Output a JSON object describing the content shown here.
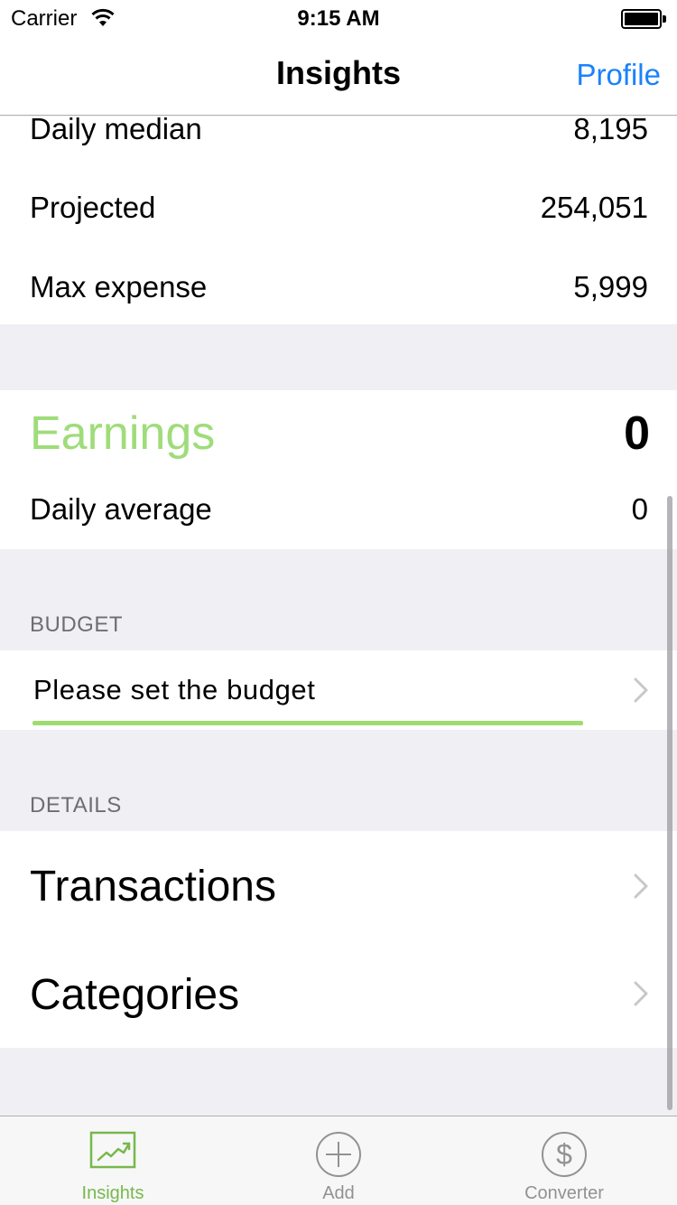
{
  "status_bar": {
    "carrier": "Carrier",
    "time": "9:15 AM"
  },
  "nav": {
    "title": "Insights",
    "profile": "Profile"
  },
  "stats": [
    {
      "label": "Daily median",
      "value": "8,195"
    },
    {
      "label": "Projected",
      "value": "254,051"
    },
    {
      "label": "Max expense",
      "value": "5,999"
    }
  ],
  "earnings": {
    "title": "Earnings",
    "total": "0",
    "daily_average_label": "Daily average",
    "daily_average_value": "0"
  },
  "budget": {
    "header": "BUDGET",
    "prompt": "Please set the budget",
    "progress_fraction": 1.0
  },
  "details": {
    "header": "DETAILS",
    "items": [
      "Transactions",
      "Categories"
    ]
  },
  "tabs": [
    {
      "label": "Insights",
      "icon": "chart-trend-icon",
      "active": true
    },
    {
      "label": "Add",
      "icon": "plus-circle-icon",
      "active": false
    },
    {
      "label": "Converter",
      "icon": "dollar-circle-icon",
      "active": false
    }
  ],
  "colors": {
    "accent_blue": "#1a82fb",
    "earnings_green": "#9fdc7a",
    "progress_green": "#9fdc6f",
    "tab_active": "#77b84c",
    "tab_inactive": "#929292",
    "group_bg": "#efeff4"
  }
}
